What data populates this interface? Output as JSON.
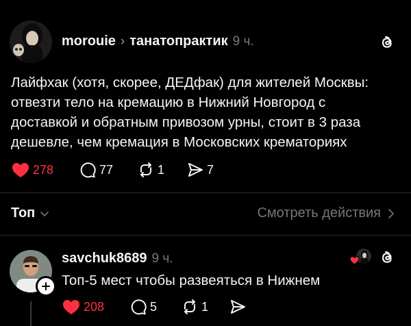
{
  "post": {
    "username": "morouie",
    "community": "танатопрактик",
    "time": "9 ч.",
    "text_lines": [
      "Лайфхак (хотя, скорее, ДЕДфак) для жителей Москвы:",
      "отвезти тело на кремацию в Нижний Новгород с",
      "доставкой и обратным привозом урны, стоит в 3 раза",
      "дешевле, чем кремация в Московских крематориях"
    ],
    "likes": "278",
    "replies": "77",
    "reposts": "1",
    "shares": "7"
  },
  "filter": {
    "label": "Топ",
    "view_activity": "Смотреть действия"
  },
  "reply": {
    "username": "savchuk8689",
    "time": "9 ч.",
    "text": "Топ-5 мест чтобы развеяться в Нижнем",
    "likes": "208",
    "replies": "5",
    "reposts": "1"
  },
  "colors": {
    "like_red": "#ff3040",
    "background": "#000000",
    "muted": "#777777"
  }
}
